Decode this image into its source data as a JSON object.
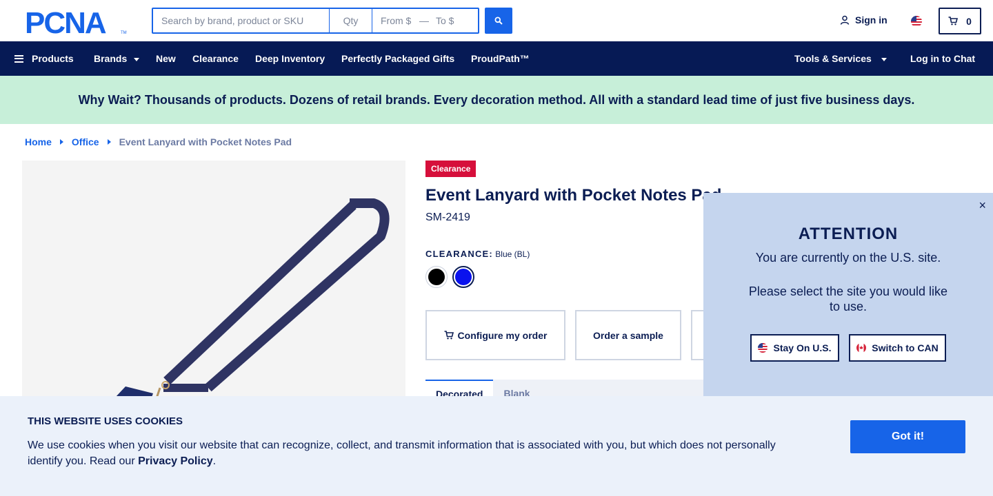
{
  "header": {
    "logo_text": "PCNA",
    "search_placeholder": "Search by brand, product or SKU",
    "qty_placeholder": "Qty",
    "from_placeholder": "From $",
    "price_dash": "—",
    "to_placeholder": "To $",
    "signin_label": "Sign in",
    "cart_count": "0"
  },
  "nav": {
    "products": "Products",
    "brands": "Brands",
    "new": "New",
    "clearance": "Clearance",
    "deep_inventory": "Deep Inventory",
    "perfectly_packaged": "Perfectly Packaged Gifts",
    "proudpath": "ProudPath™",
    "tools_services": "Tools & Services",
    "log_in_chat": "Log in to Chat"
  },
  "banner": {
    "text": "Why Wait? Thousands of products. Dozens of retail brands. Every decoration method. All with a standard lead time of just five business days."
  },
  "breadcrumb": {
    "home": "Home",
    "office": "Office",
    "current": "Event Lanyard with Pocket Notes Pad"
  },
  "product": {
    "badge": "Clearance",
    "title": "Event Lanyard with Pocket Notes Pad",
    "sku": "SM-2419",
    "clearance_label": "CLEARANCE:",
    "selected_color": "Blue (BL)",
    "swatches": [
      {
        "name": "Black",
        "color": "#000000"
      },
      {
        "name": "Blue",
        "color": "#0a12ee"
      }
    ],
    "configure_label": "Configure my order",
    "sample_label": "Order a sample"
  },
  "tabs": {
    "tab1": "Decorated",
    "tab2": "Blank"
  },
  "attention": {
    "close": "×",
    "title": "ATTENTION",
    "line1": "You are currently on the U.S. site.",
    "line2": "Please select the site you would like to use.",
    "stay_label": "Stay On U.S.",
    "switch_label": "Switch to CAN"
  },
  "cookie": {
    "title": "THIS WEBSITE USES COOKIES",
    "text": "We use cookies when you visit our website that can recognize, collect, and transmit information that is associated with you, but which does not personally identify you. Read our ",
    "link": "Privacy Policy",
    "period": ".",
    "button": "Got it!"
  },
  "colors": {
    "navy": "#061a55",
    "accent_blue": "#1764e8",
    "banner_green": "#c7efd9",
    "clearance_red": "#d60f3b"
  }
}
